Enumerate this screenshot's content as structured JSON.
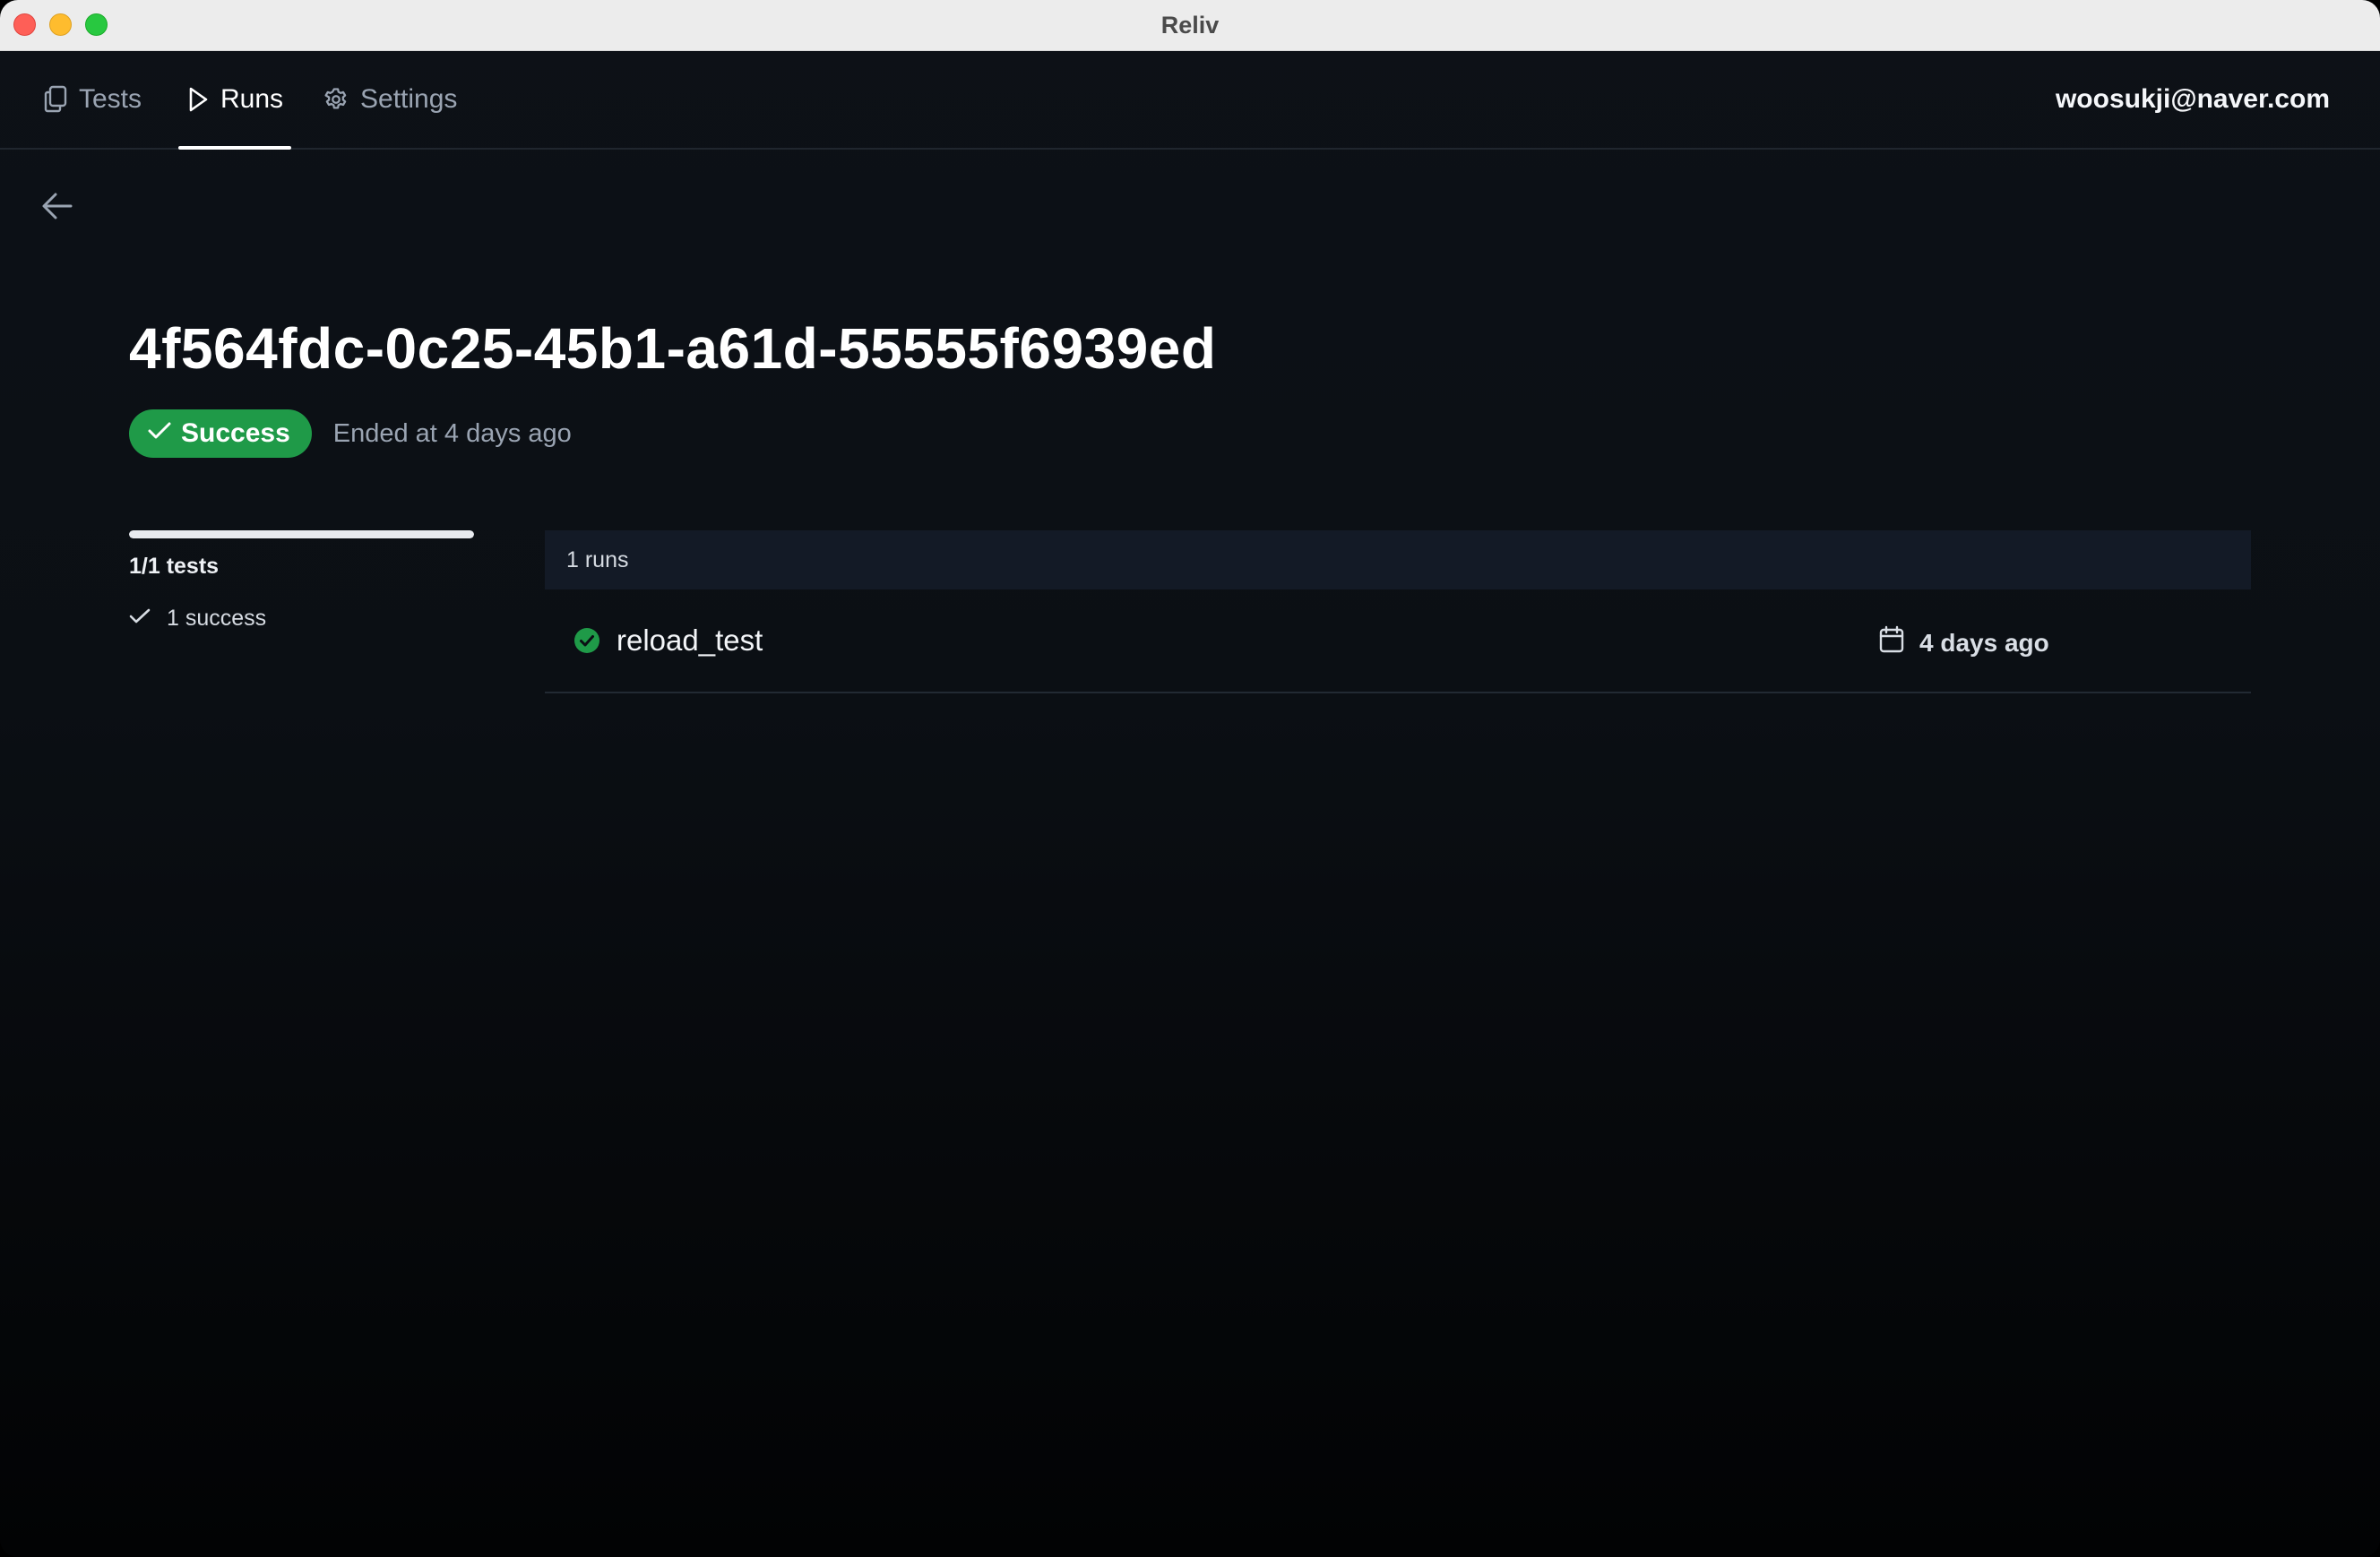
{
  "window": {
    "title": "Reliv"
  },
  "nav": {
    "tabs": [
      {
        "label": "Tests",
        "icon": "copy-icon",
        "active": false
      },
      {
        "label": "Runs",
        "icon": "play-icon",
        "active": true
      },
      {
        "label": "Settings",
        "icon": "gear-icon",
        "active": false
      }
    ],
    "user_email": "woosukji@naver.com"
  },
  "run": {
    "id": "4f564fdc-0c25-45b1-a61d-55555f6939ed",
    "status": "Success",
    "ended": "Ended at 4 days ago"
  },
  "summary": {
    "progress_fraction": 1.0,
    "tests_label": "1/1 tests",
    "success_label": "1 success"
  },
  "runs": {
    "header": "1 runs",
    "items": [
      {
        "name": "reload_test",
        "status": "success",
        "date": "4 days ago"
      }
    ]
  },
  "colors": {
    "success": "#1f9a48",
    "background": "#0b0f14",
    "accent_text": "#ffffff",
    "muted_text": "#9aa4b2"
  }
}
